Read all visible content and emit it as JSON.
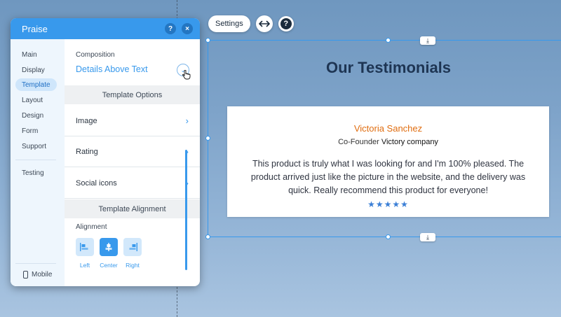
{
  "colors": {
    "accent": "#3899ec",
    "name": "#e06d10",
    "title": "#1e3553",
    "stars": "#3b7fd6"
  },
  "toolbar": {
    "settings_label": "Settings",
    "stretch_icon": "horizontal-arrows-icon",
    "help_glyph": "?"
  },
  "section": {
    "title": "Our Testimonials",
    "download_glyph": "⤓"
  },
  "testimonial": {
    "name": "Victoria Sanchez",
    "role": "Co-Founder",
    "company": "Victory company",
    "text": "This product is truly what I was looking for and I'm 100% pleased. The product arrived just like the picture in the website, and the delivery was quick. Really recommend this product for everyone!",
    "rating": 5,
    "stars": "★★★★★"
  },
  "panel": {
    "title": "Praise",
    "help_glyph": "?",
    "close_glyph": "×",
    "nav": {
      "main": "Main",
      "display": "Display",
      "template": "Template",
      "layout": "Layout",
      "design": "Design",
      "form": "Form",
      "support": "Support",
      "testing": "Testing",
      "mobile": "Mobile"
    },
    "composition": {
      "label": "Composition",
      "value": "Details Above Text",
      "dropdown_glyph": "⌄"
    },
    "template_options": {
      "heading": "Template Options",
      "image": "Image",
      "rating": "Rating",
      "social": "Social icons",
      "chevron": "›"
    },
    "template_alignment": {
      "heading": "Template Alignment",
      "label": "Alignment",
      "left": "Left",
      "center": "Center",
      "right": "Right",
      "selected": "Center"
    }
  }
}
